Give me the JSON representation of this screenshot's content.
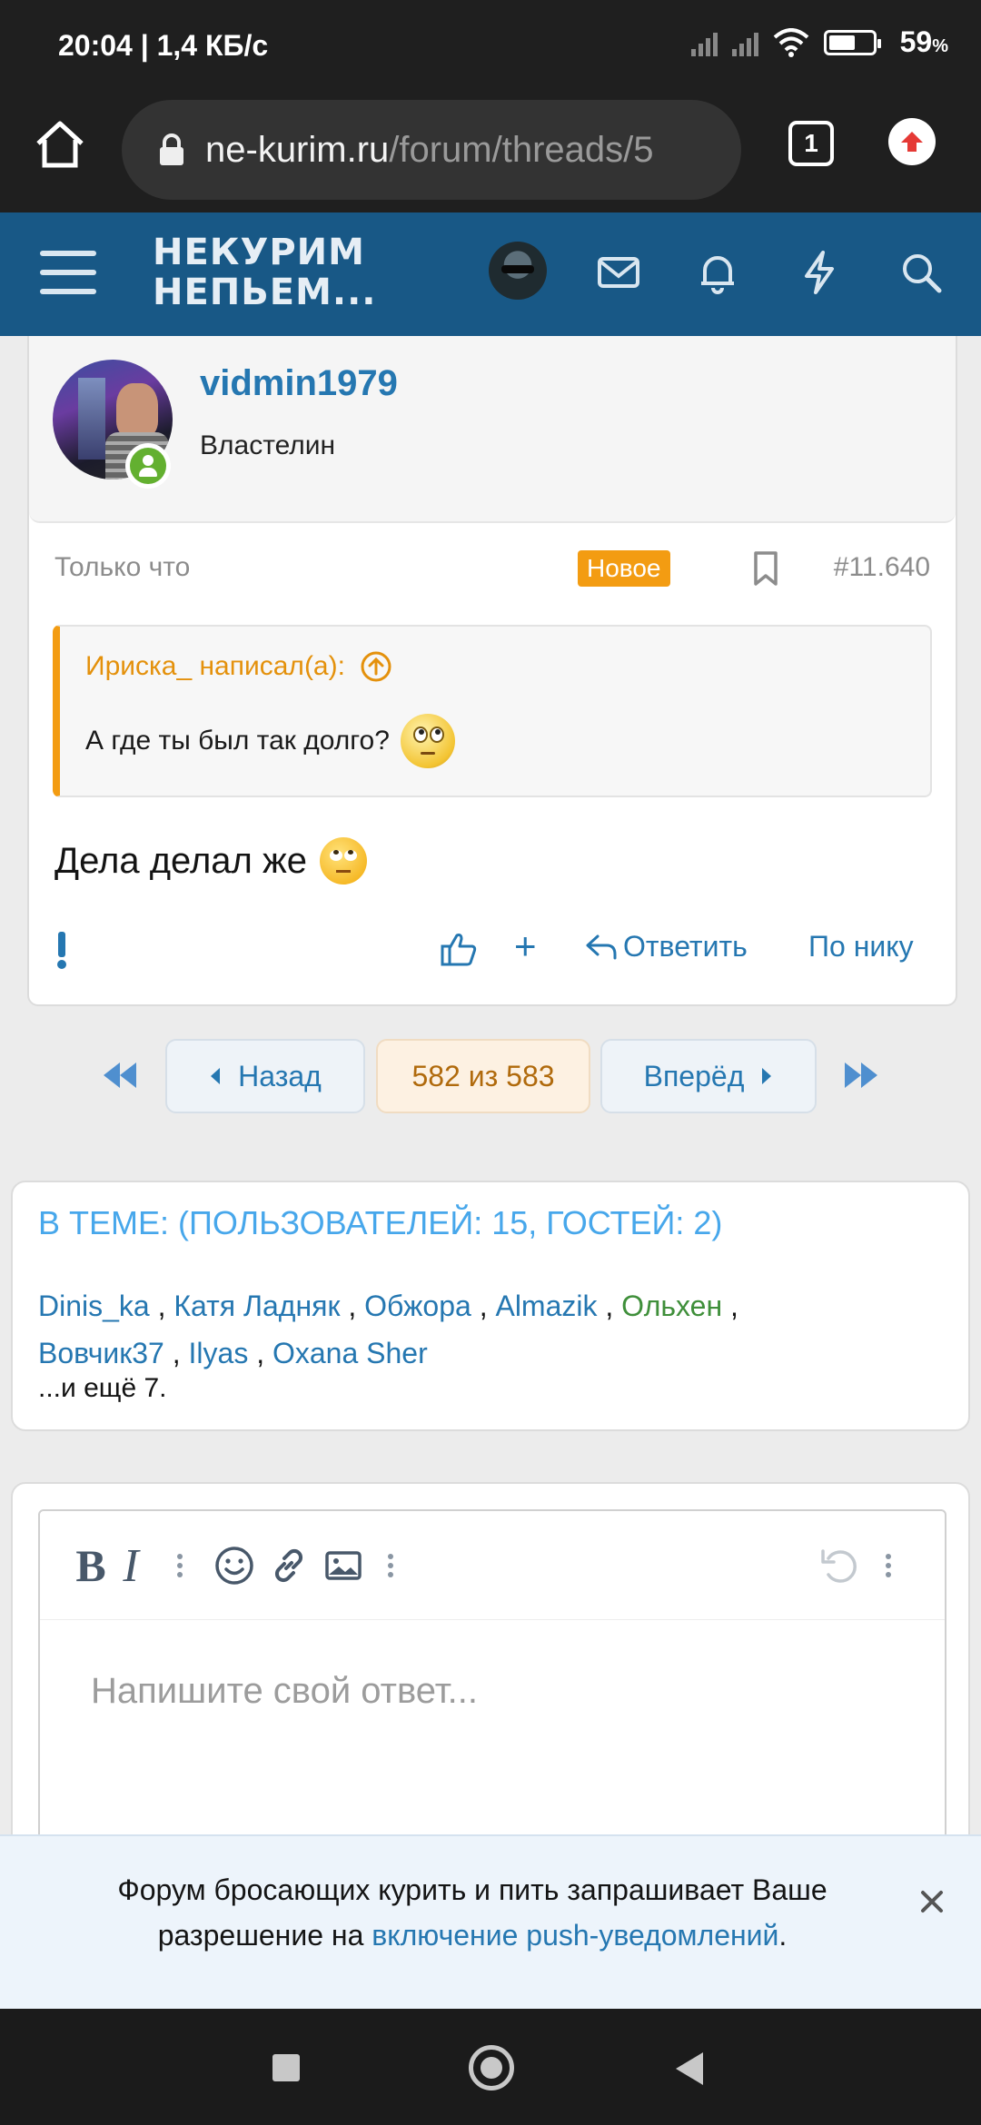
{
  "status_bar": {
    "time": "20:04",
    "speed": "1,4 КБ/с",
    "battery": "59",
    "battery_unit": "%"
  },
  "browser": {
    "url_domain": "ne-kurim.ru",
    "url_path": "/forum/threads/5",
    "tab_count": "1",
    "icons": [
      "home-icon",
      "lock-icon",
      "tabs-icon",
      "upload-extension-icon"
    ]
  },
  "site_header": {
    "logo_line1": "НЕКУРИМ",
    "logo_line2": "НЕПЬЕМ...",
    "icons": [
      "menu-icon",
      "avatar",
      "mail-icon",
      "bell-icon",
      "lightning-icon",
      "search-icon"
    ]
  },
  "post": {
    "username": "vidmin1979",
    "user_title": "Властелин",
    "time": "Только что",
    "badge": "Новое",
    "number": "#11.640",
    "quote_author": "Ириска_ написал(а):",
    "quote_text": "А где ты был так долго?",
    "text": "Дела делал же",
    "actions": {
      "reply": "Ответить",
      "by_nick": "По нику"
    }
  },
  "pagination": {
    "prev": "Назад",
    "current": "582 из 583",
    "next": "Вперёд",
    "current_page": 582,
    "total_pages": 583
  },
  "online_block": {
    "title": "В ТЕМЕ: (ПОЛЬЗОВАТЕЛЕЙ: 15, ГОСТЕЙ: 2)",
    "users": [
      "Dinis_ka",
      "Катя Ладняк",
      "Обжора",
      "Almazik",
      "Ольхен",
      "Вовчик37",
      "Ilyas",
      "Oxana Sher"
    ],
    "more": "...и ещё 7."
  },
  "editor": {
    "bold_label": "B",
    "italic_label": "I",
    "placeholder": "Напишите свой ответ..."
  },
  "push_banner": {
    "text_before": "Форум бросающих курить и пить запрашивает Ваше разрешение на ",
    "link": "включение push-уведомлений",
    "text_after": "."
  },
  "colors": {
    "header_bg": "#185886",
    "link": "#2577b1",
    "badge_new": "#f39c12",
    "online_green": "#63b030"
  }
}
